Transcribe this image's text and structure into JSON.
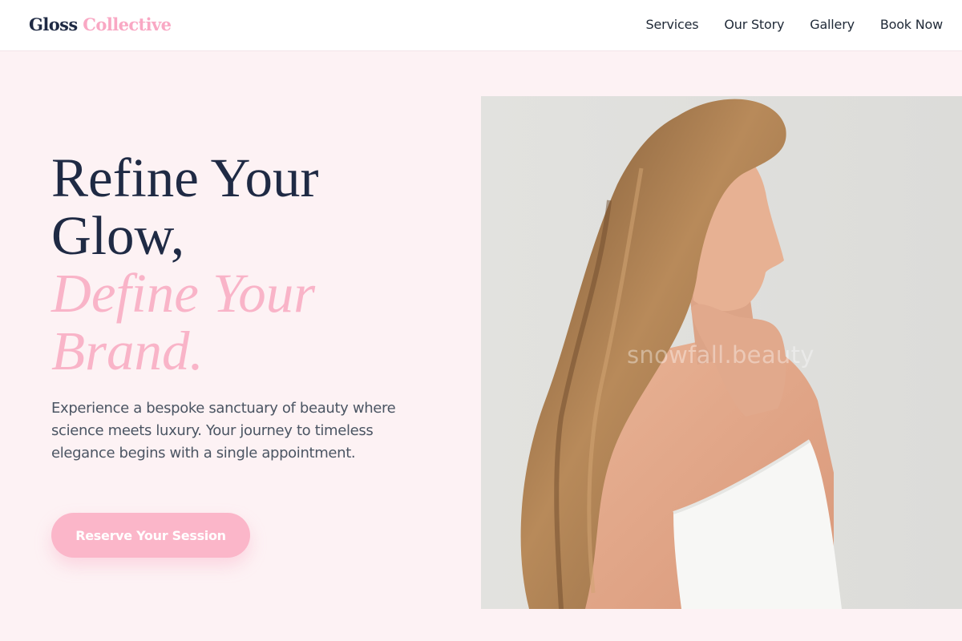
{
  "brand": {
    "name_part1": "Gloss",
    "name_part2": "Collective",
    "accent_color": "#f9a8c4",
    "dark_color": "#1f2a44"
  },
  "nav": {
    "items": [
      {
        "label": "Services"
      },
      {
        "label": "Our Story"
      },
      {
        "label": "Gallery"
      },
      {
        "label": "Book Now"
      }
    ]
  },
  "hero": {
    "title_line1": "Refine Your",
    "title_line2": "Glow,",
    "title_accent_line1": "Define Your",
    "title_accent_line2": "Brand.",
    "description": "Experience a bespoke sanctuary of beauty where science meets luxury. Your journey to timeless elegance begins with a single appointment.",
    "cta_label": "Reserve Your Session"
  },
  "image": {
    "watermark": "snowfall.beauty"
  }
}
